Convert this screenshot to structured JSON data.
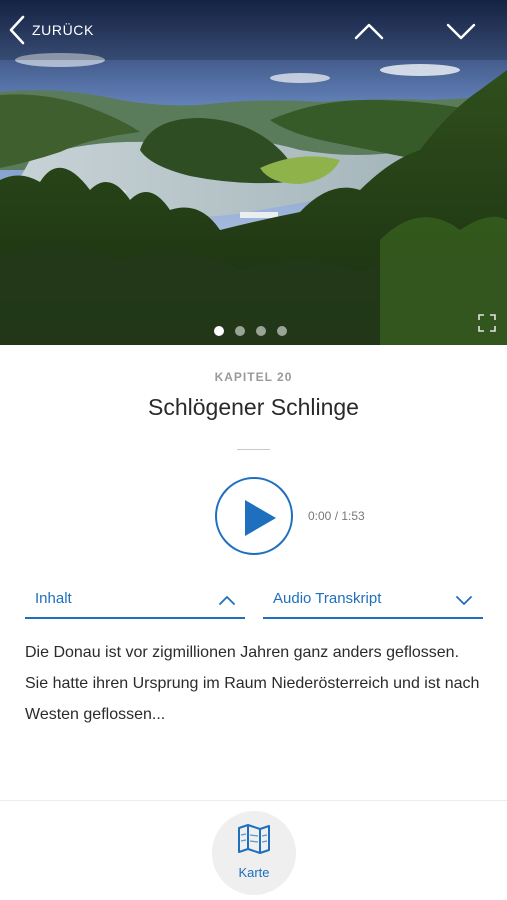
{
  "header": {
    "back_label": "ZURÜCK"
  },
  "hero": {
    "dots_count": 4,
    "active_dot_index": 0
  },
  "chapter": {
    "label": "KAPITEL 20",
    "title": "Schlögener Schlinge"
  },
  "player": {
    "time": "0:00 / 1:53"
  },
  "tabs": [
    {
      "label": "Inhalt",
      "state": "expanded"
    },
    {
      "label": "Audio Transkript",
      "state": "collapsed"
    }
  ],
  "content": {
    "text": "Die Donau ist vor zigmillionen Jahren ganz anders geflossen. Sie hatte ihren Ursprung im Raum Niederösterreich und ist nach Westen geflossen..."
  },
  "bottom_nav": {
    "map_label": "Karte"
  },
  "colors": {
    "accent": "#1f6fbf",
    "muted": "#9a9a9a"
  },
  "icons": {
    "back": "chevron-left-icon",
    "up": "chevron-up-icon",
    "down": "chevron-down-icon",
    "play": "play-icon",
    "map": "map-icon",
    "expand": "expand-icon"
  }
}
